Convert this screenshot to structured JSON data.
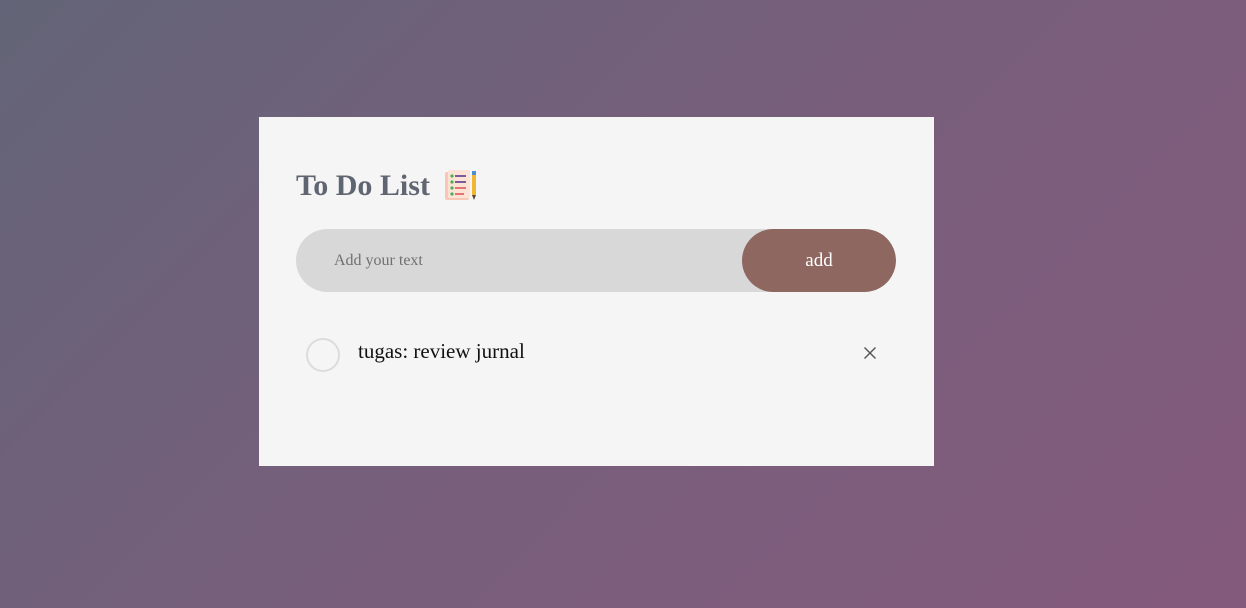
{
  "app": {
    "title": "To Do List",
    "title_icon": "checklist-notepad-icon"
  },
  "input": {
    "placeholder": "Add your text",
    "value": ""
  },
  "add_button": {
    "label": "add"
  },
  "tasks": [
    {
      "text": "tugas: review jurnal",
      "checked": false,
      "check_icon": "empty-circle-icon",
      "delete_icon": "close-x-icon"
    }
  ],
  "colors": {
    "background_gradient": [
      "#636477",
      "#845a7c"
    ],
    "card": "#f5f5f5",
    "title": "#606671",
    "input_bg": "#d8d8d8",
    "accent": "#8e6761"
  }
}
